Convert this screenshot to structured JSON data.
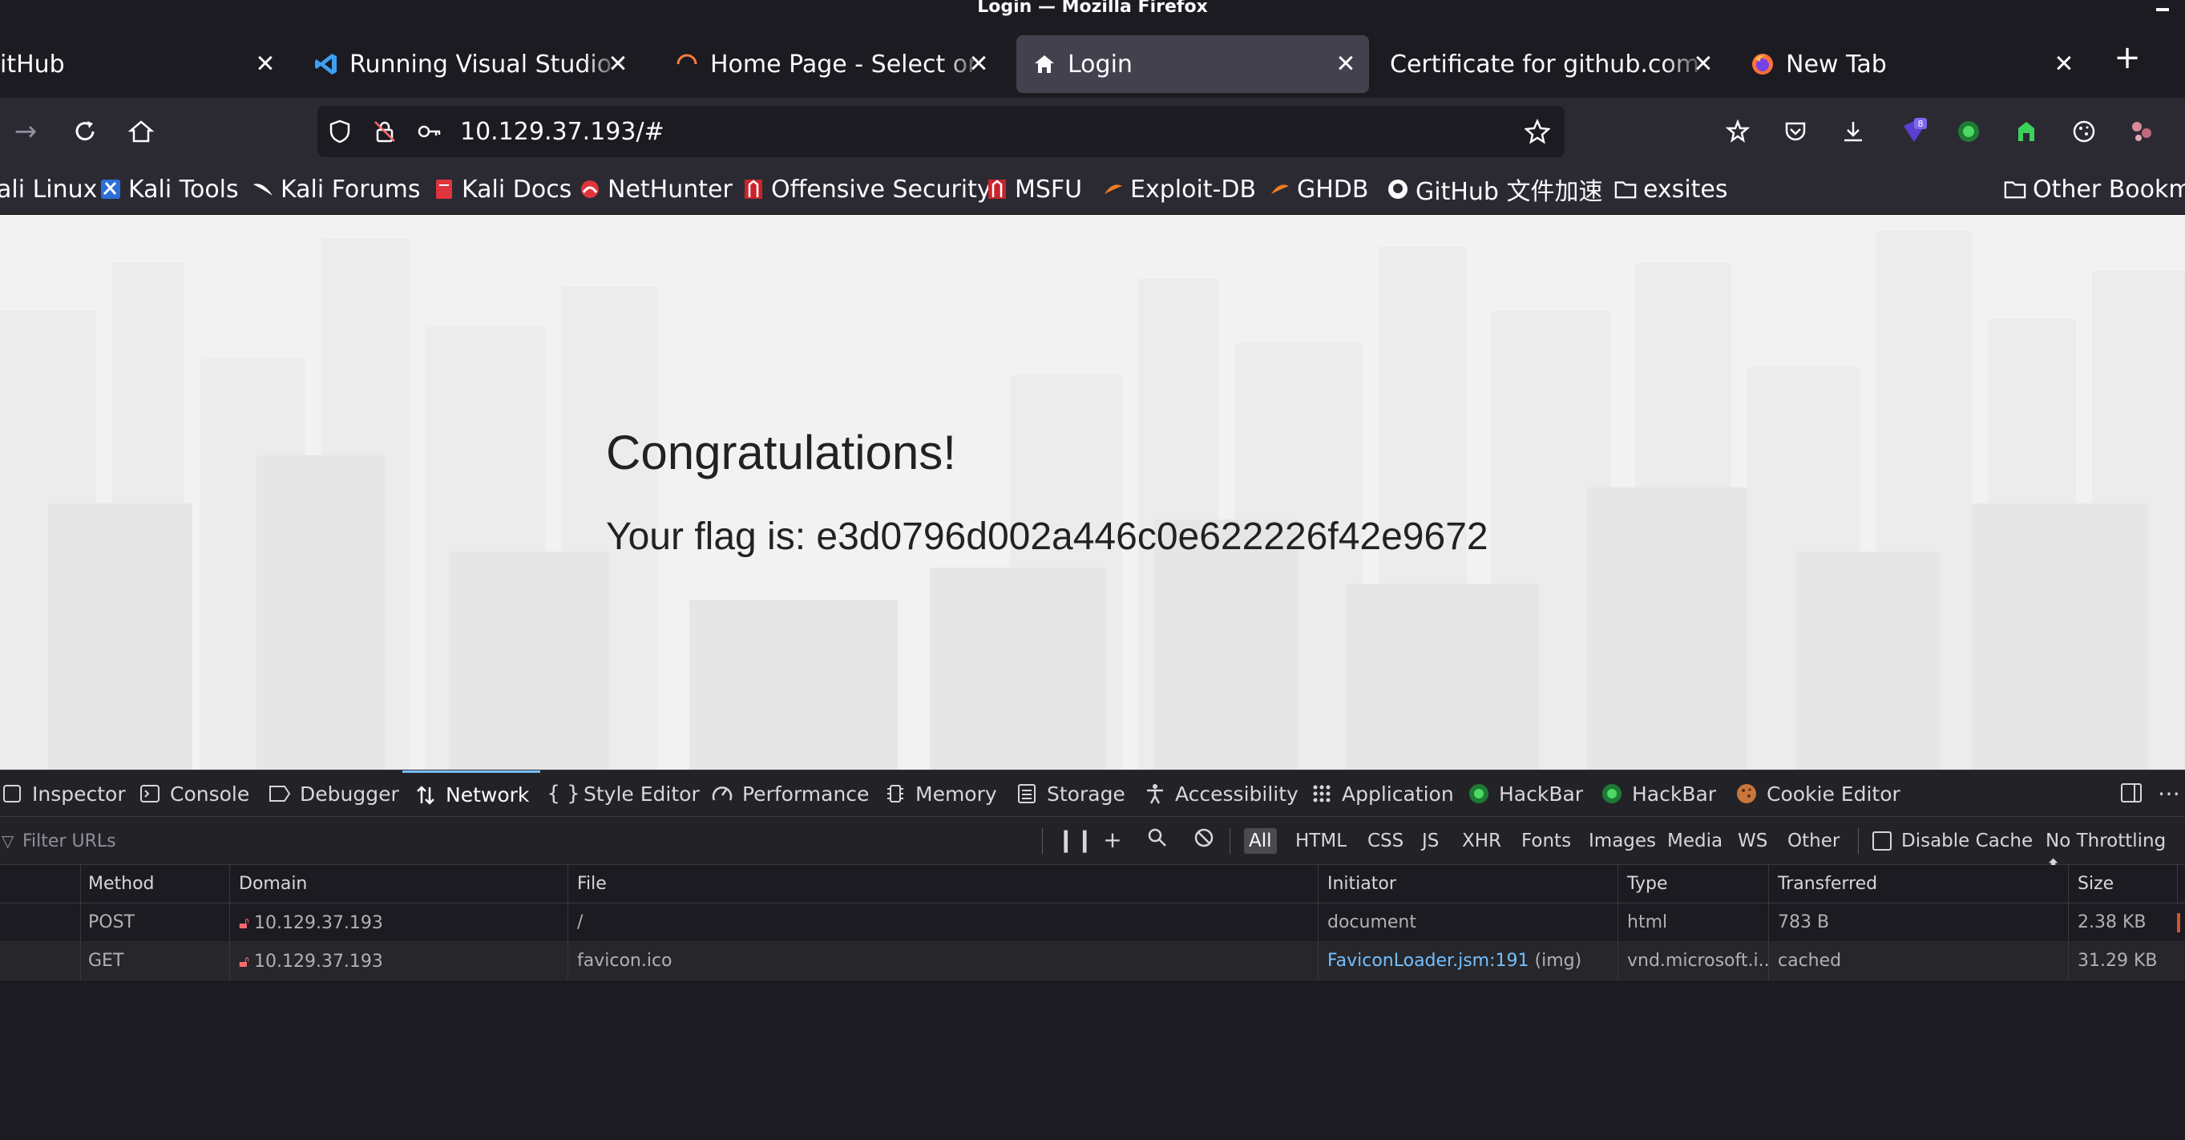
{
  "window": {
    "title": "Login — Mozilla Firefox"
  },
  "tabs": [
    {
      "label": "itHub",
      "icon": "github-icon",
      "active": false
    },
    {
      "label": "Running Visual Studio Code",
      "icon": "vscode-icon",
      "active": false
    },
    {
      "label": "Home Page - Select or create",
      "icon": "loading-icon",
      "active": false
    },
    {
      "label": "Login",
      "icon": "home-icon",
      "active": true
    },
    {
      "label": "Certificate for github.com",
      "icon": "",
      "active": false
    },
    {
      "label": "New Tab",
      "icon": "firefox-icon",
      "active": false
    }
  ],
  "navbar": {
    "url": "10.129.37.193/#"
  },
  "bookmarks": [
    {
      "label": "ali Linux"
    },
    {
      "label": "Kali Tools"
    },
    {
      "label": "Kali Forums"
    },
    {
      "label": "Kali Docs"
    },
    {
      "label": "NetHunter"
    },
    {
      "label": "Offensive Security"
    },
    {
      "label": "MSFU"
    },
    {
      "label": "Exploit-DB"
    },
    {
      "label": "GHDB"
    },
    {
      "label": "GitHub 文件加速"
    },
    {
      "label": "exsites"
    },
    {
      "label": "Other Bookma"
    }
  ],
  "page": {
    "heading": "Congratulations!",
    "flag_text": "Your flag is: e3d0796d002a446c0e622226f42e9672"
  },
  "devtools": {
    "tabs": [
      {
        "label": "Inspector"
      },
      {
        "label": "Console"
      },
      {
        "label": "Debugger"
      },
      {
        "label": "Network",
        "active": true
      },
      {
        "label": "Style Editor"
      },
      {
        "label": "Performance"
      },
      {
        "label": "Memory"
      },
      {
        "label": "Storage"
      },
      {
        "label": "Accessibility"
      },
      {
        "label": "Application"
      },
      {
        "label": "HackBar"
      },
      {
        "label": "HackBar"
      },
      {
        "label": "Cookie Editor"
      }
    ],
    "filter_placeholder": "Filter URLs",
    "type_filters": [
      "All",
      "HTML",
      "CSS",
      "JS",
      "XHR",
      "Fonts",
      "Images",
      "Media",
      "WS",
      "Other"
    ],
    "disable_cache_label": "Disable Cache",
    "throttling": "No Throttling ⬍",
    "columns": [
      "Method",
      "Domain",
      "File",
      "Initiator",
      "Type",
      "Transferred",
      "Size"
    ],
    "requests": [
      {
        "method": "POST",
        "domain": "10.129.37.193",
        "file": "/",
        "initiator": "document",
        "initiator_suffix": "",
        "type": "html",
        "transferred": "783 B",
        "size": "2.38 KB"
      },
      {
        "method": "GET",
        "domain": "10.129.37.193",
        "file": "favicon.ico",
        "initiator": "FaviconLoader.jsm:191",
        "initiator_suffix": "(img)",
        "type": "vnd.microsoft.i...",
        "transferred": "cached",
        "size": "31.29 KB"
      }
    ]
  }
}
